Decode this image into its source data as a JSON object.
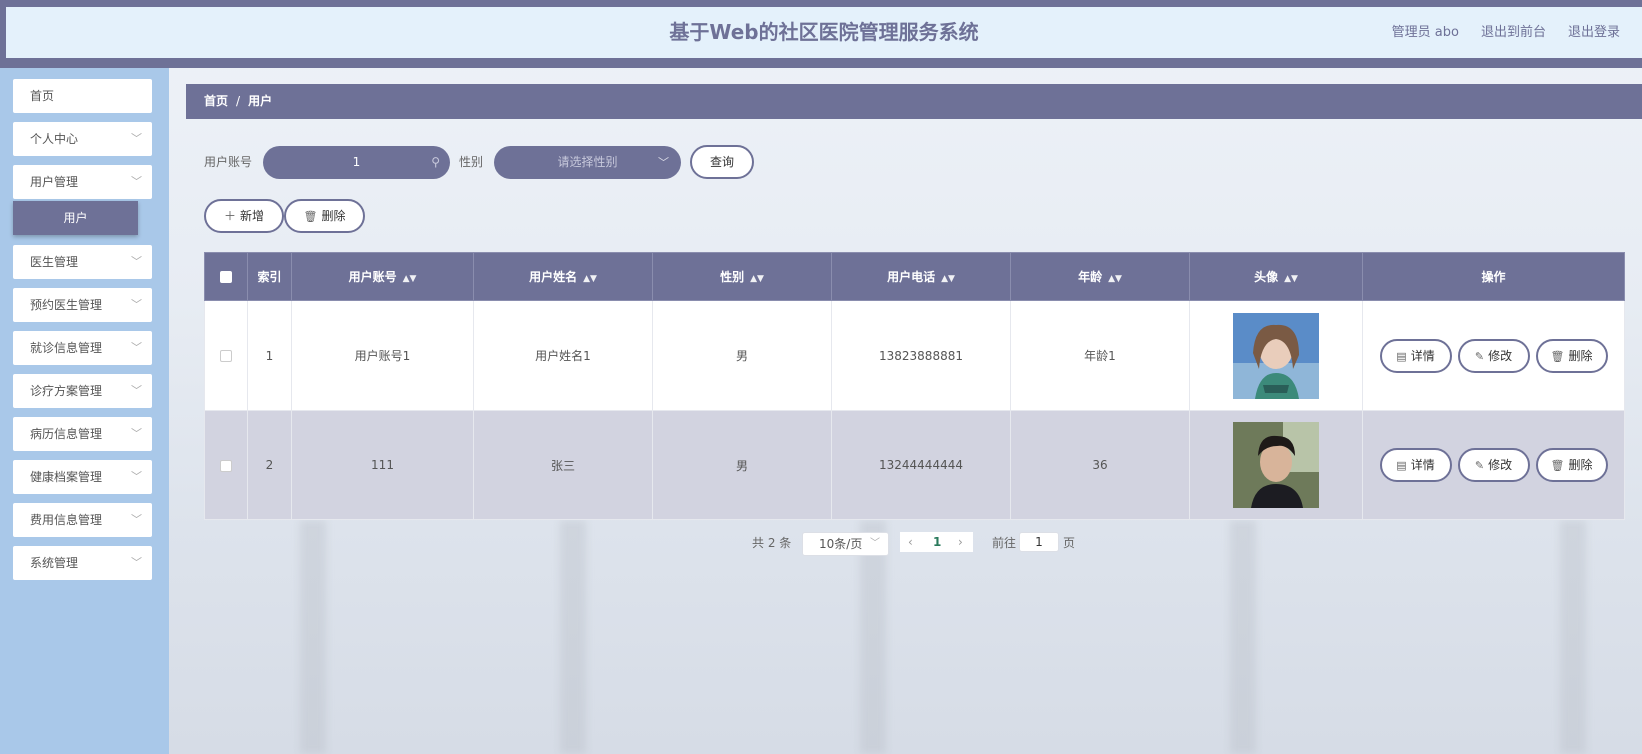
{
  "header": {
    "title": "基于Web的社区医院管理服务系统",
    "links": [
      "管理员 abo",
      "退出到前台",
      "退出登录"
    ]
  },
  "sidebar": {
    "items": [
      {
        "label": "首页",
        "has_children": false
      },
      {
        "label": "个人中心",
        "has_children": true
      },
      {
        "label": "用户管理",
        "has_children": true
      },
      {
        "label": "医生管理",
        "has_children": true
      },
      {
        "label": "预约医生管理",
        "has_children": true
      },
      {
        "label": "就诊信息管理",
        "has_children": true
      },
      {
        "label": "诊疗方案管理",
        "has_children": true
      },
      {
        "label": "病历信息管理",
        "has_children": true
      },
      {
        "label": "健康档案管理",
        "has_children": true
      },
      {
        "label": "费用信息管理",
        "has_children": true
      },
      {
        "label": "系统管理",
        "has_children": true
      }
    ],
    "active_sub": "用户"
  },
  "breadcrumb": {
    "home": "首页",
    "separator": "/",
    "current": "用户"
  },
  "search": {
    "account_label": "用户账号",
    "account_value": "1",
    "gender_label": "性别",
    "gender_placeholder": "请选择性别",
    "query_button": "查询"
  },
  "actions": {
    "add": "新增",
    "delete": "删除"
  },
  "table": {
    "columns": [
      "索引",
      "用户账号",
      "用户姓名",
      "性别",
      "用户电话",
      "年龄",
      "头像",
      "操作"
    ],
    "rows": [
      {
        "index": "1",
        "account": "用户账号1",
        "name": "用户姓名1",
        "gender": "男",
        "phone": "13823888881",
        "age": "年龄1",
        "avatar": "female-portrait"
      },
      {
        "index": "2",
        "account": "111",
        "name": "张三",
        "gender": "男",
        "phone": "13244444444",
        "age": "36",
        "avatar": "male-portrait"
      }
    ],
    "row_actions": {
      "detail": "详情",
      "edit": "修改",
      "delete": "删除"
    }
  },
  "pagination": {
    "total": "共 2 条",
    "page_size": "10条/页",
    "current_page": "1",
    "goto_label": "前往",
    "goto_value": "1",
    "page_suffix": "页"
  },
  "colors": {
    "primary": "#6e7197",
    "sidebar": "#a9c8e9",
    "header_bg": "#e4f1fb"
  }
}
